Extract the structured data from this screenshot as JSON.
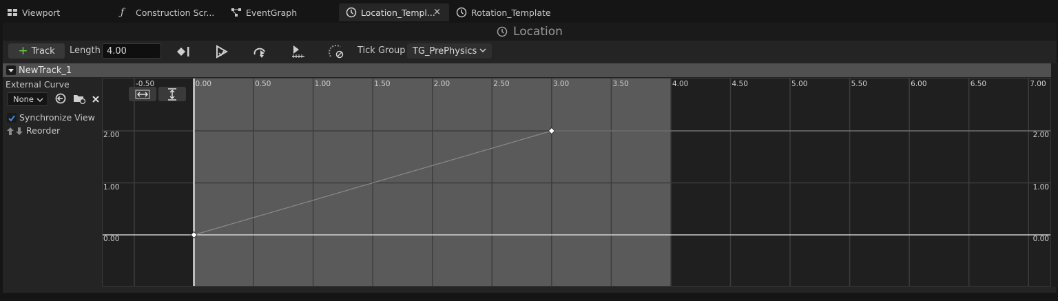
{
  "tabs": [
    {
      "label": "Viewport",
      "icon": "viewport-icon",
      "active": false
    },
    {
      "label": "Construction Scr...",
      "icon": "function-icon",
      "active": false
    },
    {
      "label": "EventGraph",
      "icon": "graph-icon",
      "active": false
    },
    {
      "label": "Location_Templ...",
      "icon": "timeline-clock-icon",
      "active": true,
      "close": "×"
    },
    {
      "label": "Rotation_Template",
      "icon": "timeline-clock-icon",
      "active": false
    }
  ],
  "panel_title": "Location",
  "toolbar": {
    "track_label": "Track",
    "length_label": "Length",
    "length_value": "4.00",
    "tick_group_label": "Tick Group",
    "tick_group_value": "TG_PrePhysics"
  },
  "track": {
    "name": "NewTrack_1",
    "external_curve_label": "External Curve",
    "curve_value": "None",
    "synchronize_label": "Synchronize View",
    "synchronize_checked": true,
    "reorder_label": "Reorder"
  },
  "graph": {
    "x_ticks": [
      "-0.50",
      "0.00",
      "0.50",
      "1.00",
      "1.50",
      "2.00",
      "2.50",
      "3.00",
      "3.50",
      "4.00",
      "4.50",
      "5.00",
      "5.50",
      "6.00",
      "6.50",
      "7.00"
    ],
    "y_labels_left": [
      "2.00",
      "1.00",
      "0.00"
    ],
    "y_labels_right": [
      "2.00",
      "1.00",
      "0.00"
    ],
    "keys": [
      {
        "time": 0.0,
        "value": 0.0
      },
      {
        "time": 3.0,
        "value": 2.0
      }
    ],
    "timeline_length": 4.0,
    "colors": {
      "active_range": "#5a5a5a",
      "inactive": "#232323",
      "curve": "#8a8a8a"
    }
  }
}
